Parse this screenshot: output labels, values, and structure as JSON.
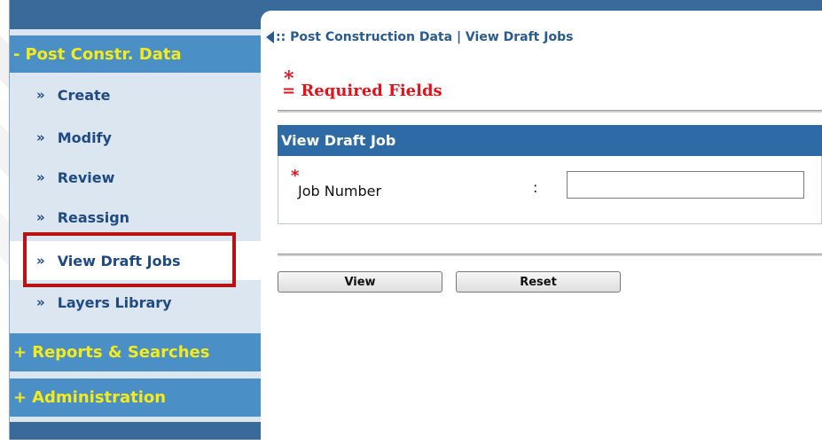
{
  "sidebar": {
    "sections": [
      {
        "sign": "-",
        "label": "Post Constr. Data"
      },
      {
        "sign": "+",
        "label": "Reports & Searches"
      },
      {
        "sign": "+",
        "label": "Administration"
      }
    ],
    "items": [
      {
        "label": "Create"
      },
      {
        "label": "Modify"
      },
      {
        "label": "Review"
      },
      {
        "label": "Reassign"
      },
      {
        "label": "View Draft Jobs",
        "active": true
      },
      {
        "label": "Layers Library"
      }
    ],
    "chevron": "»"
  },
  "breadcrumb": {
    "prefix": ":: ",
    "path": "Post Construction Data | View Draft Jobs"
  },
  "required": {
    "star": "*",
    "text": "= Required Fields"
  },
  "form": {
    "title": "View Draft Job",
    "field": {
      "star": "*",
      "label": "Job Number",
      "colon": ":",
      "value": ""
    },
    "buttons": {
      "view": "View",
      "reset": "Reset"
    }
  },
  "colors": {
    "sidebar_header": "#4a90c6",
    "sidebar_header_text": "#f5ea1c",
    "panel_header": "#2e6aa6",
    "required": "#e0121c",
    "highlight": "#b81212"
  },
  "icons": {
    "breadcrumb_back": "back-triangle-icon",
    "bullet": "double-chevron-icon"
  }
}
